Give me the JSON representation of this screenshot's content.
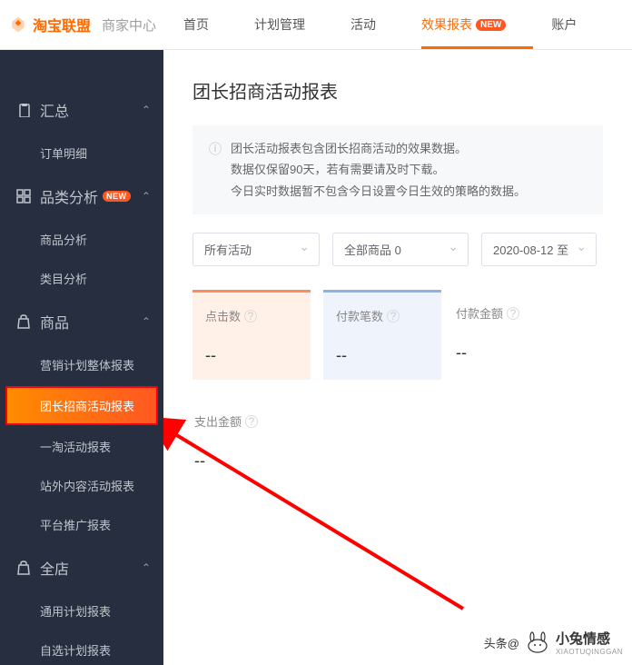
{
  "header": {
    "logo_text": "淘宝联盟",
    "sub_brand": "商家中心",
    "nav": [
      {
        "label": "首页"
      },
      {
        "label": "计划管理"
      },
      {
        "label": "活动"
      },
      {
        "label": "效果报表",
        "active": true,
        "new": true
      },
      {
        "label": "账户"
      }
    ]
  },
  "sidebar": {
    "groups": [
      {
        "icon": "clipboard",
        "label": "汇总",
        "subs": [
          "订单明细"
        ]
      },
      {
        "icon": "grid",
        "label": "品类分析",
        "new": true,
        "subs": [
          "商品分析",
          "类目分析"
        ]
      },
      {
        "icon": "bag",
        "label": "商品",
        "subs": [
          "营销计划整体报表",
          "团长招商活动报表",
          "一淘活动报表",
          "站外内容活动报表",
          "平台推广报表"
        ],
        "highlighted_index": 1
      },
      {
        "icon": "bag",
        "label": "全店",
        "subs": [
          "通用计划报表",
          "自选计划报表"
        ]
      }
    ]
  },
  "content": {
    "title": "团长招商活动报表",
    "info_lines": "团长活动报表包含团长招商活动的效果数据。\n数据仅保留90天，若有需要请及时下载。\n今日实时数据暂不包含今日设置今日生效的策略的数据。",
    "filters": {
      "activity": "所有活动",
      "goods": "全部商品 0",
      "date": "2020-08-12 至"
    },
    "metrics_row1": [
      {
        "label": "点击数",
        "value": "--",
        "style": "orange"
      },
      {
        "label": "付款笔数",
        "value": "--",
        "style": "blue"
      },
      {
        "label": "付款金额",
        "value": "--",
        "style": "plain"
      }
    ],
    "metrics_row2": [
      {
        "label": "支出金额",
        "value": "--",
        "style": "plain"
      }
    ]
  },
  "watermark": {
    "prefix": "头条@",
    "main": "小兔情感",
    "sub": "XIAOTUQINGGAN"
  }
}
